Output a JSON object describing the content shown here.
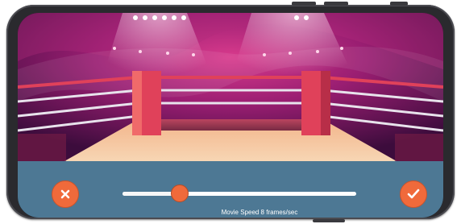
{
  "player": {
    "speed_label": "Movie Speed 8 frames/sec",
    "speed_slider_fraction": 0.24
  },
  "icons": {
    "cancel": "close-icon",
    "confirm": "checkmark-icon"
  },
  "colors": {
    "accent": "#f06a3b",
    "control_bar": "#4d7894",
    "slider_track": "#ffffff"
  }
}
